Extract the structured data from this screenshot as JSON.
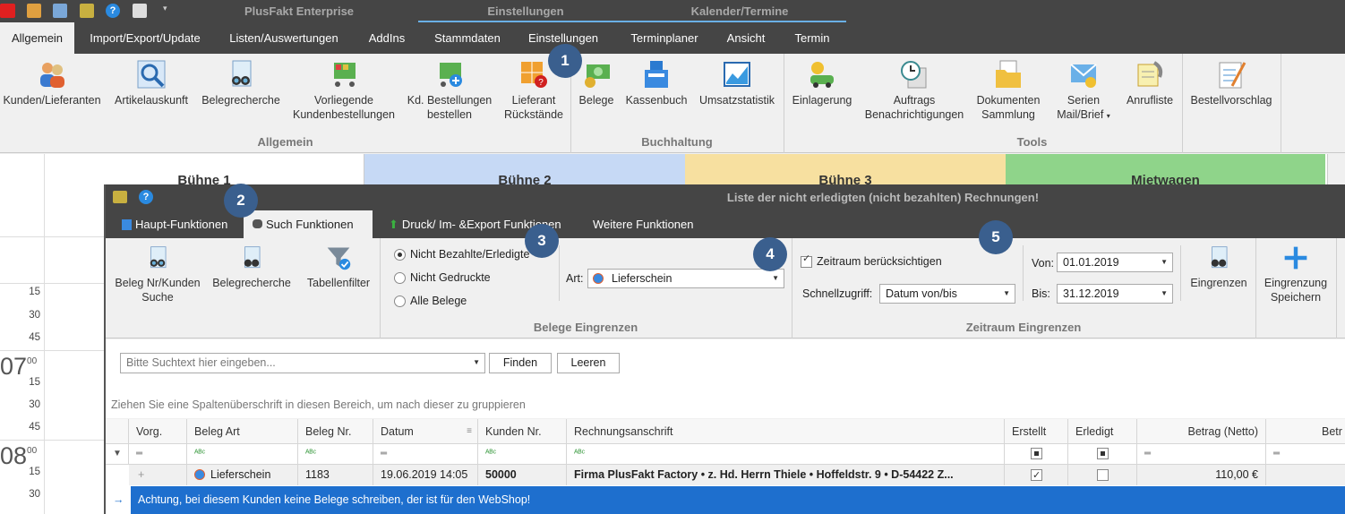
{
  "context_tabs": [
    "PlusFakt Enterprise",
    "Einstellungen",
    "Kalender/Termine"
  ],
  "menu_tabs": [
    "Allgemein",
    "Import/Export/Update",
    "Listen/Auswertungen",
    "AddIns",
    "Stammdaten",
    "Einstellungen",
    "Terminplaner",
    "Ansicht",
    "Termin"
  ],
  "ribbon": {
    "allgemein": [
      "Kunden/Lieferanten",
      "Artikelauskunft",
      "Belegrecherche",
      "Vorliegende Kundenbestellungen",
      "Kd. Bestellungen bestellen",
      "Lieferant Rückstände"
    ],
    "buchhaltung": [
      "Belege",
      "Kassenbuch",
      "Umsatzstatistik"
    ],
    "tools": [
      "Einlagerung",
      "Auftrags Benachrichtigungen",
      "Dokumenten Sammlung",
      "Serien Mail/Brief",
      "Anrufliste",
      "Bestellvorschlag"
    ],
    "groups": [
      "Allgemein",
      "Buchhaltung",
      "Tools"
    ]
  },
  "calendar": {
    "resources": [
      "Bühne 1",
      "Bühne 2",
      "Bühne 3",
      "Mietwagen"
    ],
    "resource_colors": [
      "#ffffff",
      "#c6d9f5",
      "#f7e0a0",
      "#8fd48a"
    ],
    "times": [
      "15",
      "30",
      "45",
      "07",
      "15",
      "30",
      "45",
      "08",
      "15",
      "30"
    ]
  },
  "dialog": {
    "title": "Liste der nicht erledigten (nicht bezahlten) Rechnungen!",
    "tabs": [
      "Haupt-Funktionen",
      "Such Funktionen",
      "Druck/ Im- &Export Funktionen",
      "Weitere Funktionen"
    ],
    "buttons": {
      "beleg_nr": "Beleg Nr/Kunden Suche",
      "belegrecherche": "Belegrecherche",
      "tabellenfilter": "Tabellenfilter",
      "eingrenzen": "Eingrenzen",
      "eingrenzung_speichern": "Eingrenzung Speichern"
    },
    "radios": [
      "Nicht Bezahlte/Erledigte",
      "Nicht Gedruckte",
      "Alle Belege"
    ],
    "art_label": "Art:",
    "art_value": "Lieferschein",
    "zeitraum_check": "Zeitraum berücksichtigen",
    "schnellzugriff_label": "Schnellzugriff:",
    "schnellzugriff_value": "Datum von/bis",
    "von_label": "Von:",
    "von_value": "01.01.2019",
    "bis_label": "Bis:",
    "bis_value": "31.12.2019",
    "groups": [
      "Belege Eingrenzen",
      "Zeitraum Eingrenzen"
    ],
    "search_placeholder": "Bitte Suchtext hier eingeben...",
    "find": "Finden",
    "clear": "Leeren",
    "group_hint": "Ziehen Sie eine Spaltenüberschrift in diesen Bereich, um nach dieser zu gruppieren",
    "columns": [
      "Vorg.",
      "Beleg Art",
      "Beleg Nr.",
      "Datum",
      "Kunden Nr.",
      "Rechnungsanschrift",
      "Erstellt",
      "Erledigt",
      "Betrag (Netto)",
      "Betr"
    ],
    "row": {
      "art": "Lieferschein",
      "nr": "1183",
      "datum": "19.06.2019 14:05",
      "kunde": "50000",
      "anschrift": "Firma PlusFakt Factory  • z. Hd. Herrn Thiele • Hoffeldstr. 9 • D-54422 Z...",
      "betrag": "110,00 €"
    },
    "warning": "Achtung, bei diesem Kunden keine Belege schreiben, der ist für den WebShop!"
  },
  "badges": [
    "1",
    "2",
    "3",
    "4",
    "5"
  ]
}
